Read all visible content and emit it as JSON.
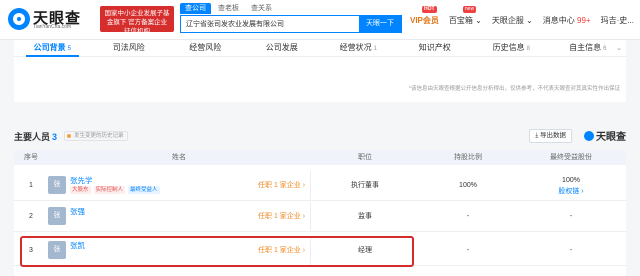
{
  "header": {
    "logo_text": "天眼查",
    "logo_sub": "TianYanCha.com",
    "gov_badge": "国家中小企业发展子基金旗下 官方备案企业征信机构",
    "search_tabs": [
      "查公司",
      "查老板",
      "查关系"
    ],
    "search_value": "辽宁省张司发农业发展有限公司",
    "search_button": "天眼一下",
    "nav": {
      "vip": "VIP会员",
      "vip_badge": "HOT",
      "baibao": "百宝箱",
      "baibao_badge": "new",
      "enterprise": "天眼企服",
      "messages": "消息中心",
      "messages_count": "99+",
      "user": "玛吉·史..."
    }
  },
  "tabs": [
    {
      "label": "公司背景",
      "count": "5",
      "active": true
    },
    {
      "label": "司法风险",
      "count": ""
    },
    {
      "label": "经营风险",
      "count": ""
    },
    {
      "label": "公司发展",
      "count": ""
    },
    {
      "label": "经营状况",
      "count": "1"
    },
    {
      "label": "知识产权",
      "count": ""
    },
    {
      "label": "历史信息",
      "count": "8"
    },
    {
      "label": "自主信息",
      "count": "6"
    }
  ],
  "data_note": "*该信息由天眼查根据公开信息分析得出，仅供参考，不代表天眼查对其真实性作出保证",
  "section": {
    "title": "主要人员",
    "count": "3",
    "history_tag": "发生变更的历史记录",
    "download": "导出数据",
    "brand": "天眼查"
  },
  "table": {
    "headers": [
      "序号",
      "姓名",
      "职位",
      "持股比例",
      "最终受益股份"
    ],
    "rows": [
      {
        "index": "1",
        "avatar": "张",
        "name": "张先学",
        "tags": [
          "大股东",
          "实际控制人",
          "最终受益人"
        ],
        "office": "任职 1 家企业 ›",
        "position": "执行董事",
        "share": "100%",
        "equity": "100%",
        "equity_link": "股权链 ›"
      },
      {
        "index": "2",
        "avatar": "张",
        "name": "张强",
        "tags": [],
        "office": "任职 1 家企业 ›",
        "position": "监事",
        "share": "-",
        "equity": "-",
        "equity_link": ""
      },
      {
        "index": "3",
        "avatar": "张",
        "name": "张凯",
        "tags": [],
        "office": "任职 1 家企业 ›",
        "position": "经理",
        "share": "-",
        "equity": "-",
        "equity_link": ""
      }
    ]
  },
  "colors": {
    "accent": "#0084ff",
    "highlight": "#d42b2b",
    "link_orange": "#f08a24"
  }
}
